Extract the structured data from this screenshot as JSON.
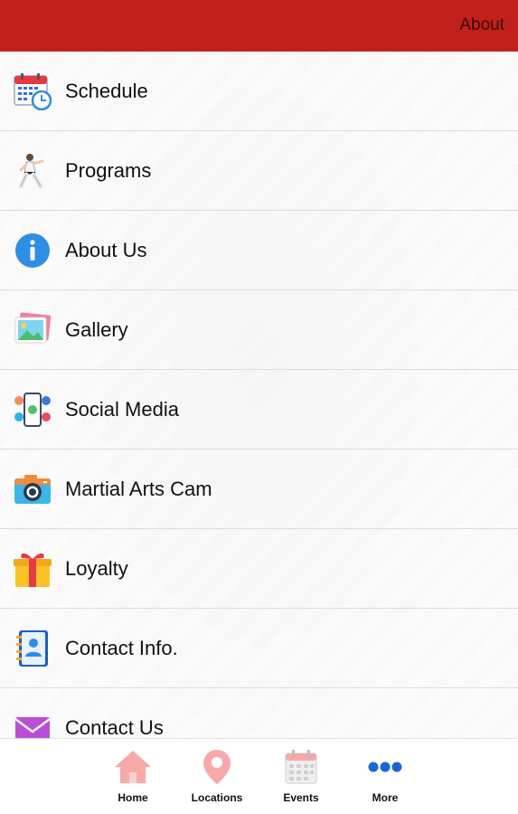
{
  "header": {
    "title": "About"
  },
  "menu": {
    "items": [
      {
        "label": "Schedule",
        "icon": "calendar-clock-icon"
      },
      {
        "label": "Programs",
        "icon": "karate-person-icon"
      },
      {
        "label": "About Us",
        "icon": "info-icon"
      },
      {
        "label": "Gallery",
        "icon": "gallery-image-icon"
      },
      {
        "label": "Social Media",
        "icon": "social-media-phone-icon"
      },
      {
        "label": "Martial Arts Cam",
        "icon": "camera-icon"
      },
      {
        "label": "Loyalty",
        "icon": "gift-icon"
      },
      {
        "label": "Contact Info.",
        "icon": "contact-book-icon"
      },
      {
        "label": "Contact Us",
        "icon": "envelope-icon"
      }
    ]
  },
  "tabbar": {
    "tabs": [
      {
        "label": "Home",
        "icon": "home-icon"
      },
      {
        "label": "Locations",
        "icon": "location-pin-icon"
      },
      {
        "label": "Events",
        "icon": "calendar-icon"
      },
      {
        "label": "More",
        "icon": "more-dots-icon"
      }
    ]
  },
  "colors": {
    "header": "#c2211b",
    "more_active": "#1a66d9",
    "tab_inactive": "#f2a3a3"
  }
}
